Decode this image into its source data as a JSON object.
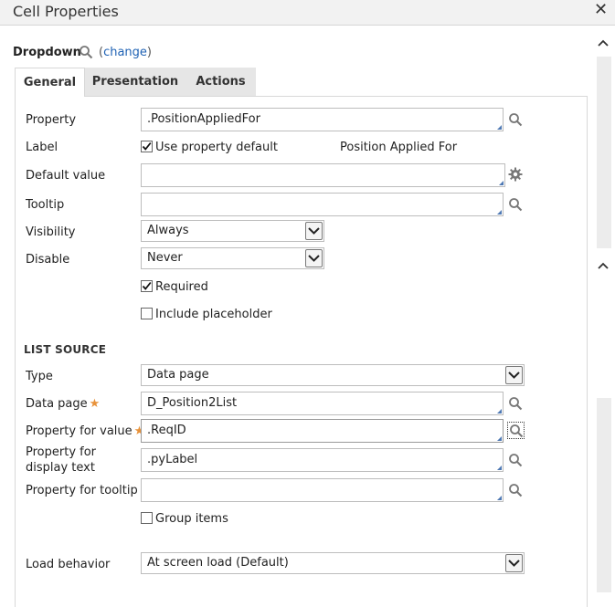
{
  "window": {
    "title": "Cell Properties"
  },
  "header": {
    "control_name": "Dropdown",
    "change_prefix": "(",
    "change_link": "change",
    "change_suffix": ")"
  },
  "tabs": [
    {
      "label": "General"
    },
    {
      "label": "Presentation"
    },
    {
      "label": "Actions"
    }
  ],
  "general": {
    "property_label": "Property",
    "property_value": ".PositionAppliedFor",
    "label_label": "Label",
    "use_default_label": "Use property default",
    "default_label_text": "Position Applied For",
    "default_value_label": "Default value",
    "default_value_value": "",
    "tooltip_label": "Tooltip",
    "tooltip_value": "",
    "visibility_label": "Visibility",
    "visibility_value": "Always",
    "disable_label": "Disable",
    "disable_value": "Never",
    "required_label": "Required",
    "include_placeholder_label": "Include placeholder"
  },
  "list_source": {
    "section_title": "LIST SOURCE",
    "type_label": "Type",
    "type_value": "Data page",
    "data_page_label": "Data page",
    "data_page_value": "D_Position2List",
    "prop_value_label": "Property for value",
    "prop_value_value": ".ReqID",
    "prop_display_label": "Property for display text",
    "prop_display_value": ".pyLabel",
    "prop_tooltip_label": "Property for tooltip",
    "prop_tooltip_value": "",
    "group_items_label": "Group items",
    "load_behavior_label": "Load behavior",
    "load_behavior_value": "At screen load (Default)"
  },
  "required_marker": "★",
  "icons": {
    "close": "close-icon",
    "search": "search-icon",
    "gear": "gear-icon",
    "chevron_up": "chevron-up-icon",
    "chevron_down": "chevron-down-icon"
  }
}
